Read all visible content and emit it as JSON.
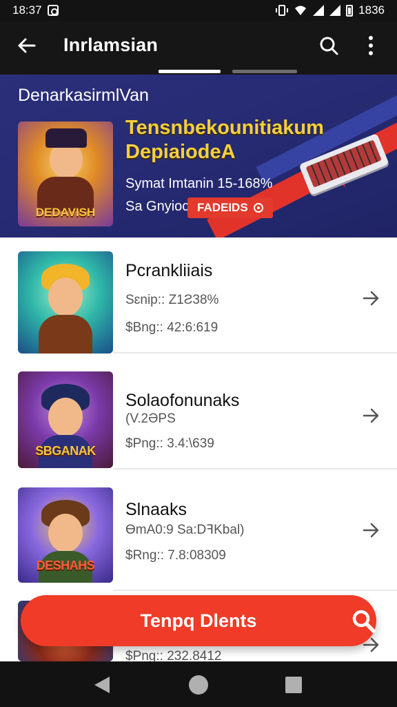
{
  "status_bar": {
    "time": "18:37",
    "battery": "1836"
  },
  "app_bar": {
    "title": "Inrlamsian",
    "back_icon": "arrow-left-icon",
    "search_icon": "search-icon",
    "more_icon": "more-vert-icon"
  },
  "banner": {
    "header": "DenarkasirmlVan",
    "headline_line1": "Tensnbekounitiakum",
    "headline_line2": "DepiaiodeA",
    "subtext": "Symat Imtanin 15-168%",
    "subtext2": "Sa Gnyioc",
    "button_label": "FADEIDS",
    "art_label": "DEDAVISH"
  },
  "items": [
    {
      "title": "Pcrankliiais",
      "sub": "Sɛnip:: Z1Ƨ38%",
      "price": "$Bng:: 42:6:619",
      "badge": ""
    },
    {
      "title": "Solaofonunaks",
      "sub": "(V.2ƏPS",
      "price": "$Png:: 3.4:\\639",
      "badge": "SBGANAK"
    },
    {
      "title": "Slnaaks",
      "sub": "ӨmA0:9 Sa:DꟻKbal)",
      "price": "$Rng:: 7.8:08309",
      "badge": "DESHAHS"
    },
    {
      "title": "",
      "sub": "",
      "price": "$Png:: 232.8412",
      "badge": ""
    }
  ],
  "fab": {
    "label": "Tenpq Dlents",
    "icon": "search-icon"
  },
  "colors": {
    "accent": "#ef3b27",
    "banner": "#272b73",
    "headline": "#f6d03c"
  }
}
